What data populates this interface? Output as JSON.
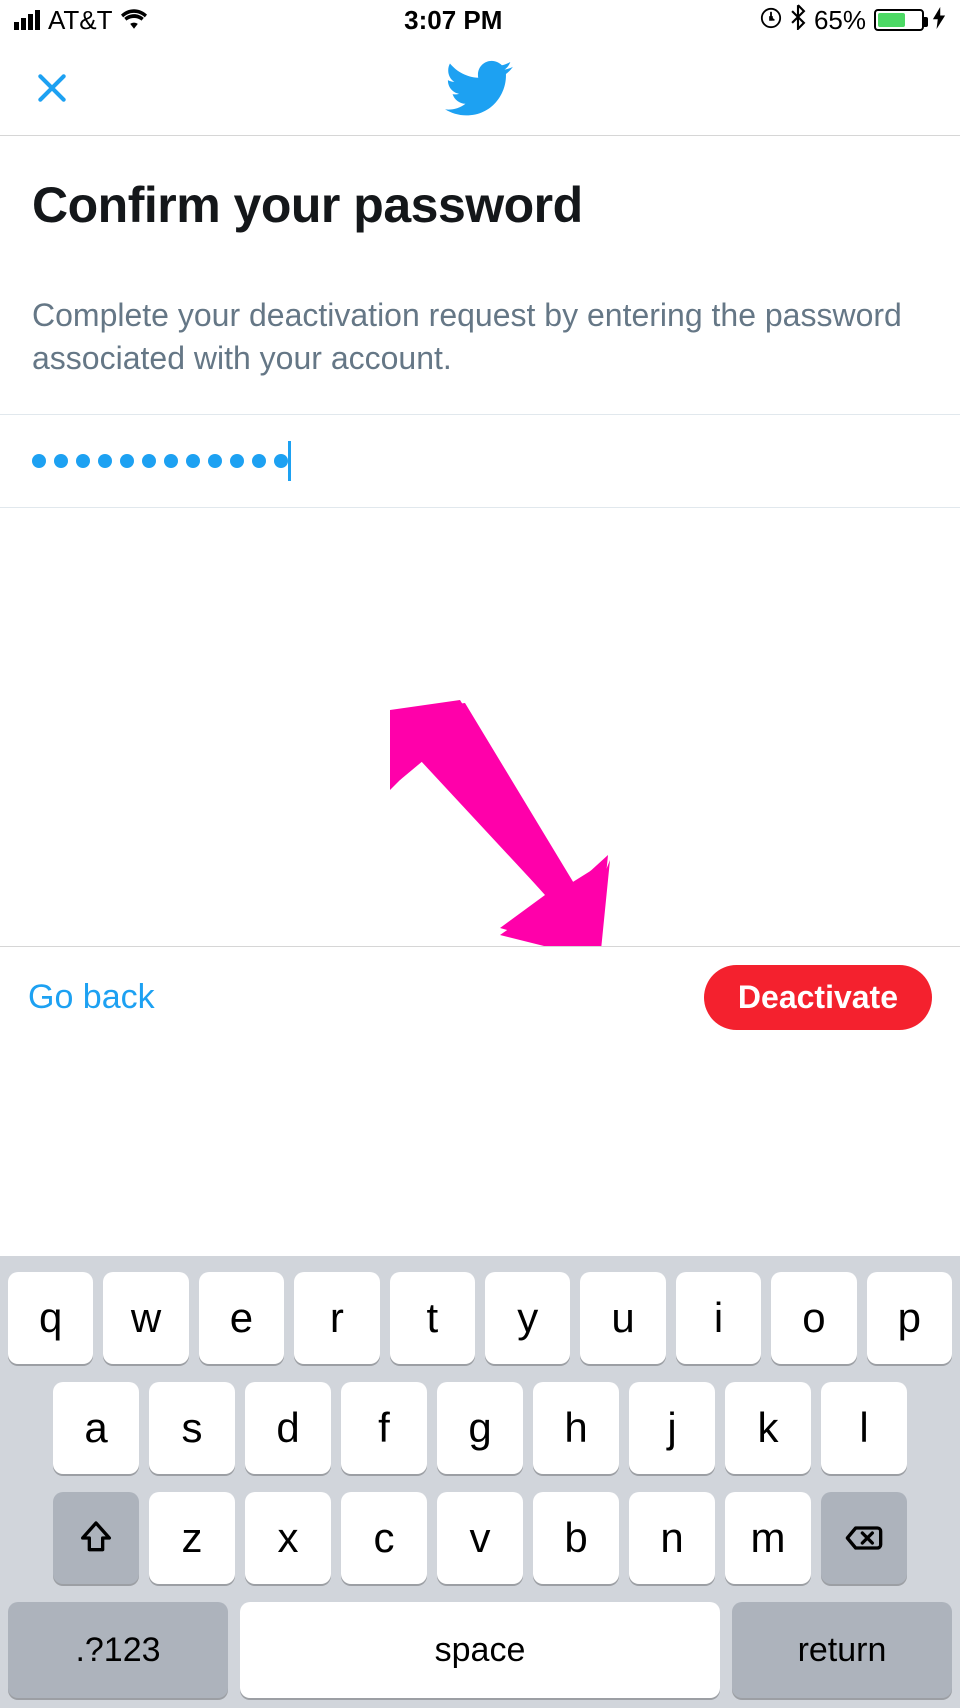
{
  "status_bar": {
    "carrier": "AT&T",
    "time": "3:07 PM",
    "battery_percent": "65%"
  },
  "nav": {
    "close_label": "Close"
  },
  "page": {
    "title": "Confirm your password",
    "description": "Complete your deactivation request by entering the password associated with your account.",
    "password_value_masked": "●●●●●●●●●●●●",
    "password_dot_count": 12
  },
  "actions": {
    "go_back_label": "Go back",
    "deactivate_label": "Deactivate"
  },
  "keyboard": {
    "row1": [
      "q",
      "w",
      "e",
      "r",
      "t",
      "y",
      "u",
      "i",
      "o",
      "p"
    ],
    "row2": [
      "a",
      "s",
      "d",
      "f",
      "g",
      "h",
      "j",
      "k",
      "l"
    ],
    "row3": [
      "z",
      "x",
      "c",
      "v",
      "b",
      "n",
      "m"
    ],
    "mode_key": ".?123",
    "space_key": "space",
    "return_key": "return"
  },
  "colors": {
    "accent": "#1da1f2",
    "danger": "#f4212e",
    "annotation": "#ff00aa"
  }
}
